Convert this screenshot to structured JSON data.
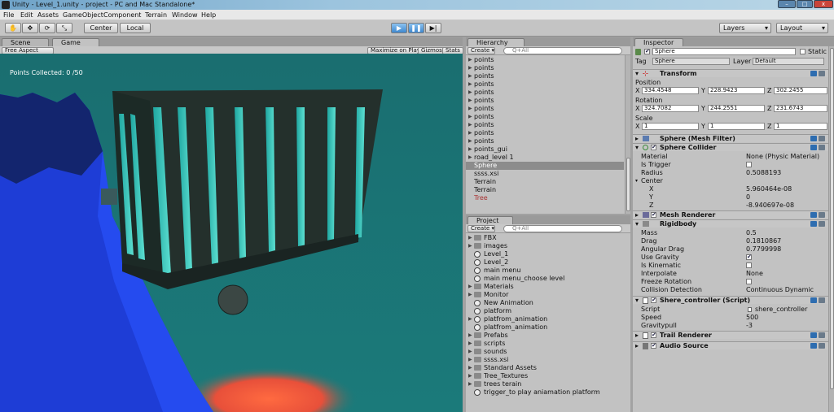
{
  "titlebar": {
    "title": "Unity - Level_1.unity - project - PC and Mac Standalone*",
    "min": "–",
    "max": "□",
    "close": "x"
  },
  "menu": [
    "File",
    "Edit",
    "Assets",
    "GameObject",
    "Component",
    "Terrain",
    "Window",
    "Help"
  ],
  "toolbar": {
    "center": "Center",
    "local": "Local",
    "layers": "Layers",
    "layout": "Layout"
  },
  "scene_tabs": {
    "scene": "Scene",
    "game": "Game"
  },
  "game_bar": {
    "aspect": "Free Aspect",
    "maximize": "Maximize on Play",
    "gizmos": "Gizmos",
    "stats": "Stats"
  },
  "game_hud": {
    "points": "Points Collected: 0 /50"
  },
  "hierarchy": {
    "title": "Hierarchy",
    "create": "Create",
    "search": "Q+All",
    "items": [
      "points",
      "points",
      "points",
      "points",
      "points",
      "points",
      "points",
      "points",
      "points",
      "points",
      "points",
      "points_gui",
      "road_level 1",
      "Sphere",
      "ssss.xsi",
      "Terrain",
      "Terrain",
      "Tree"
    ]
  },
  "project": {
    "title": "Project",
    "create": "Create",
    "search": "Q+All",
    "items": [
      {
        "label": "FBX",
        "type": "folder",
        "expand": true
      },
      {
        "label": "images",
        "type": "folder",
        "expand": true
      },
      {
        "label": "Level_1",
        "type": "scene",
        "expand": false
      },
      {
        "label": "Level_2",
        "type": "scene",
        "expand": false
      },
      {
        "label": "main menu",
        "type": "scene",
        "expand": false
      },
      {
        "label": "main menu_choose level",
        "type": "scene",
        "expand": false
      },
      {
        "label": "Materials",
        "type": "folder",
        "expand": true
      },
      {
        "label": "Monitor",
        "type": "folder",
        "expand": true
      },
      {
        "label": "New Animation",
        "type": "anim",
        "expand": false
      },
      {
        "label": "platform",
        "type": "prefab",
        "expand": false
      },
      {
        "label": "platfrom_animation",
        "type": "prefab",
        "expand": true
      },
      {
        "label": "platfrom_animation",
        "type": "anim",
        "expand": false
      },
      {
        "label": "Prefabs",
        "type": "folder",
        "expand": true
      },
      {
        "label": "scripts",
        "type": "folder",
        "expand": true
      },
      {
        "label": "sounds",
        "type": "folder",
        "expand": true
      },
      {
        "label": "ssss.xsi",
        "type": "folder",
        "expand": true
      },
      {
        "label": "Standard Assets",
        "type": "folder",
        "expand": true
      },
      {
        "label": "Tree_Textures",
        "type": "folder",
        "expand": true
      },
      {
        "label": "trees terain",
        "type": "folder",
        "expand": true
      },
      {
        "label": "trigger_to play aniamation platform",
        "type": "scene",
        "expand": false
      }
    ]
  },
  "inspector": {
    "title": "Inspector",
    "object_name": "Sphere",
    "static": "Static",
    "tag_label": "Tag",
    "tag_value": "Sphere",
    "layer_label": "Layer",
    "layer_value": "Default",
    "transform": {
      "title": "Transform",
      "position": "Position",
      "rotation": "Rotation",
      "scale": "Scale",
      "x": "X",
      "y": "Y",
      "z": "Z",
      "pos": [
        "334.4548",
        "228.9423",
        "302.2455"
      ],
      "rot": [
        "324.7082",
        "244.2551",
        "231.6743"
      ],
      "scl": [
        "1",
        "1",
        "1"
      ]
    },
    "mesh_filter": {
      "title": "Sphere (Mesh Filter)"
    },
    "sphere_collider": {
      "title": "Sphere Collider",
      "material": "Material",
      "material_val": "None (Physic Material)",
      "is_trigger": "Is Trigger",
      "radius": "Radius",
      "radius_val": "0.5088193",
      "center": "Center",
      "cx": "X",
      "cx_val": "5.960464e-08",
      "cy": "Y",
      "cy_val": "0",
      "cz": "Z",
      "cz_val": "-8.940697e-08"
    },
    "mesh_renderer": {
      "title": "Mesh Renderer"
    },
    "rigidbody": {
      "title": "Rigidbody",
      "mass": "Mass",
      "mass_val": "0.5",
      "drag": "Drag",
      "drag_val": "0.1810867",
      "angular": "Angular Drag",
      "angular_val": "0.7799998",
      "gravity": "Use Gravity",
      "kinematic": "Is Kinematic",
      "interpolate": "Interpolate",
      "interpolate_val": "None",
      "freeze": "Freeze Rotation",
      "collision": "Collision Detection",
      "collision_val": "Continuous Dynamic"
    },
    "script": {
      "title": "Shere_controller (Script)",
      "script": "Script",
      "script_val": "shere_controller",
      "speed": "Speed",
      "speed_val": "500",
      "grav": "Gravitypull",
      "grav_val": "-3"
    },
    "trail": {
      "title": "Trail Renderer"
    },
    "audio": {
      "title": "Audio Source"
    }
  }
}
